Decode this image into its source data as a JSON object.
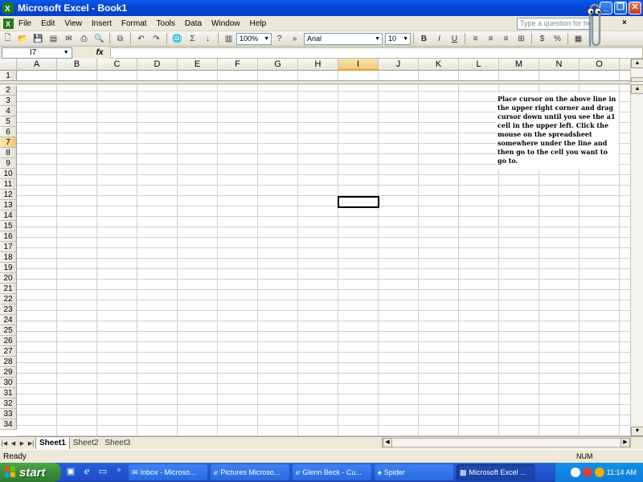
{
  "window": {
    "title": "Microsoft Excel - Book1"
  },
  "menu": {
    "items": [
      "File",
      "Edit",
      "View",
      "Insert",
      "Format",
      "Tools",
      "Data",
      "Window",
      "Help"
    ],
    "help_placeholder": "Type a question for help"
  },
  "toolbar": {
    "zoom": "100%",
    "font": "Arial",
    "font_size": "10"
  },
  "formula": {
    "name_box": "I7",
    "fx": "fx",
    "content": ""
  },
  "sheet": {
    "columns": [
      "A",
      "B",
      "C",
      "D",
      "E",
      "F",
      "G",
      "H",
      "I",
      "J",
      "K",
      "L",
      "M",
      "N",
      "O"
    ],
    "rows": [
      "1",
      "2",
      "3",
      "4",
      "5",
      "6",
      "7",
      "8",
      "9",
      "10",
      "11",
      "12",
      "13",
      "14",
      "15",
      "16",
      "17",
      "18",
      "19",
      "20",
      "21",
      "22",
      "23",
      "24",
      "25",
      "26",
      "27",
      "28",
      "29",
      "30",
      "31",
      "32",
      "33",
      "34"
    ],
    "active_cell": "I7",
    "note": "Place cursor on the above line in the upper right corner and drag cursor down until you see the a1 cell in the upper left.  Click the mouse on the spreadsheet somewhere under the line and then go to the cell you want to go to."
  },
  "tabs": [
    "Sheet1",
    "Sheet2",
    "Sheet3"
  ],
  "status": {
    "left": "Ready",
    "num": "NUM"
  },
  "taskbar": {
    "start": "start",
    "tasks": [
      "Inbox - Microso...",
      "Pictures Microso...",
      "Glenn Beck - Cu...",
      "Spider",
      "Microsoft Excel ..."
    ],
    "clock": "11:14 AM"
  },
  "colors": {
    "title_blue": "#0A5BEA",
    "start_green": "#3A8E3A",
    "selected_header": "#F0C77A",
    "excel_green": "#1D7A1D"
  }
}
